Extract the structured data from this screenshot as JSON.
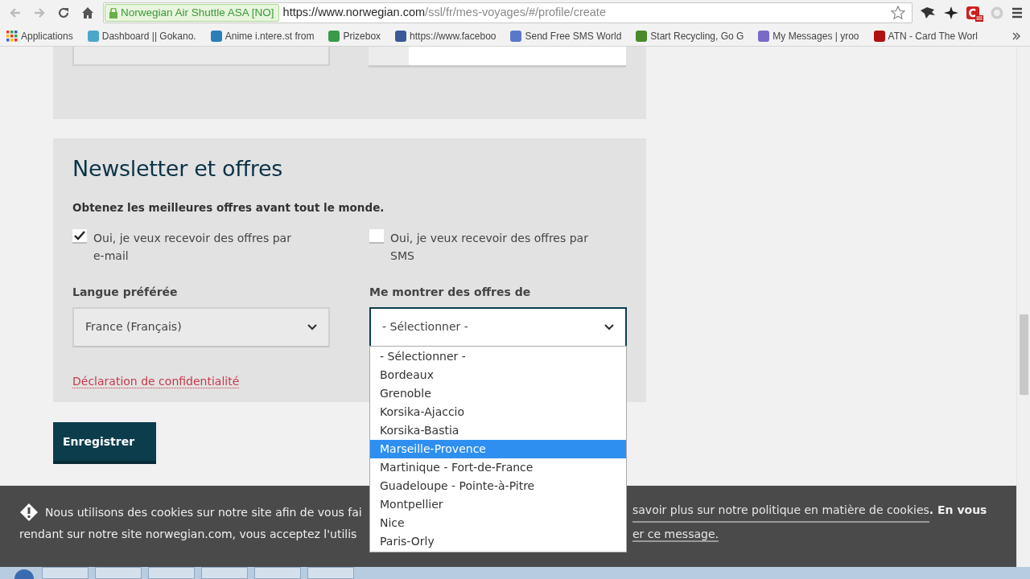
{
  "browser": {
    "secure_label": "Norwegian Air Shuttle ASA [NO]",
    "url_host": "https://www.norwegian.com",
    "url_path": "/ssl/fr/mes-voyages/#/profile/create",
    "extension_badge": "88"
  },
  "bookmarks": [
    {
      "label": "Applications",
      "kind": "grid"
    },
    {
      "label": "Dashboard || Gokano.",
      "kind": "favicon",
      "color": "#4aa8c8"
    },
    {
      "label": "Anime i.ntere.st from",
      "kind": "favicon",
      "color": "#2a7fb8"
    },
    {
      "label": "Prizebox",
      "kind": "favicon",
      "color": "#3a9a4a"
    },
    {
      "label": "https://www.faceboo",
      "kind": "favicon",
      "color": "#3b5998"
    },
    {
      "label": "Send Free SMS World",
      "kind": "favicon",
      "color": "#5a78c8"
    },
    {
      "label": "Start Recycling, Go G",
      "kind": "favicon",
      "color": "#4a8a2a"
    },
    {
      "label": "My Messages | yroo",
      "kind": "favicon",
      "color": "#7a6ac8"
    },
    {
      "label": "ATN - Card The Worl",
      "kind": "favicon",
      "color": "#b01010"
    }
  ],
  "newsletter": {
    "title": "Newsletter et offres",
    "subtitle": "Obtenez les meilleures offres avant tout le monde.",
    "checkboxes": [
      {
        "label": "Oui, je veux recevoir des offres par e-mail",
        "checked": true
      },
      {
        "label": "Oui, je veux recevoir des offres par SMS",
        "checked": false
      }
    ],
    "selects": [
      {
        "label": "Langue préférée",
        "value": "France (Français)",
        "focused": false
      },
      {
        "label": "Me montrer des offres de",
        "value": "- Sélectionner -",
        "focused": true
      }
    ],
    "privacy_link": "Déclaration de confidentialité"
  },
  "save_button": "Enregistrer",
  "dropdown": {
    "options": [
      {
        "label": "- Sélectionner -",
        "selected": false
      },
      {
        "label": "Bordeaux",
        "selected": false
      },
      {
        "label": "Grenoble",
        "selected": false
      },
      {
        "label": "Korsika-Ajaccio",
        "selected": false
      },
      {
        "label": "Korsika-Bastia",
        "selected": false
      },
      {
        "label": "Marseille-Provence",
        "selected": true
      },
      {
        "label": "Martinique - Fort-de-France",
        "selected": false
      },
      {
        "label": "Guadeloupe - Pointe-à-Pitre",
        "selected": false
      },
      {
        "label": "Montpellier",
        "selected": false
      },
      {
        "label": "Nice",
        "selected": false
      },
      {
        "label": "Paris-Orly",
        "selected": false
      }
    ]
  },
  "cookie_banner": {
    "line1_left": "Nous utilisons des cookies sur notre site afin de vous fai",
    "line1_link": "savoir plus sur notre politique en matière de cookies",
    "line1_end": ". En vous",
    "line2_left": "rendant sur notre site norwegian.com, vous acceptez l'utilis",
    "line2_link": "er ce message."
  }
}
